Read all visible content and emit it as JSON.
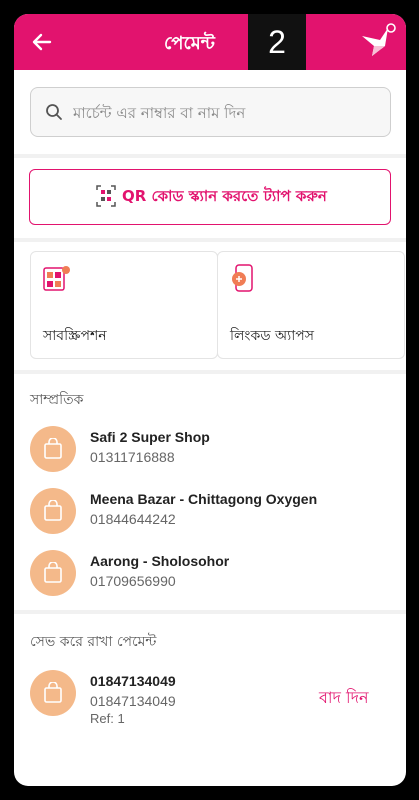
{
  "header": {
    "title": "পেমেন্ট",
    "badge": "2"
  },
  "search": {
    "placeholder": "মার্চেন্ট এর নাম্বার বা নাম দিন"
  },
  "qr": {
    "label": "QR কোড স্ক্যান করতে ট্যাপ করুন"
  },
  "cards": [
    {
      "label": "সাবস্ক্রিপশন",
      "icon": "subscription-icon"
    },
    {
      "label": "লিংকড অ্যাপস",
      "icon": "linked-apps-icon"
    }
  ],
  "recent": {
    "title": "সাম্প্রতিক",
    "items": [
      {
        "name": "Safi 2 Super Shop",
        "number": "01311716888"
      },
      {
        "name": "Meena Bazar - Chittagong Oxygen",
        "number": "01844644242"
      },
      {
        "name": "Aarong - Sholosohor",
        "number": "01709656990"
      }
    ]
  },
  "saved": {
    "title": "সেভ করে রাখা পেমেন্ট",
    "items": [
      {
        "name": "01847134049",
        "number": "01847134049",
        "ref": "Ref: 1",
        "action": "বাদ দিন"
      }
    ]
  },
  "colors": {
    "brand": "#e2136e",
    "avatar": "#f4b98a"
  }
}
